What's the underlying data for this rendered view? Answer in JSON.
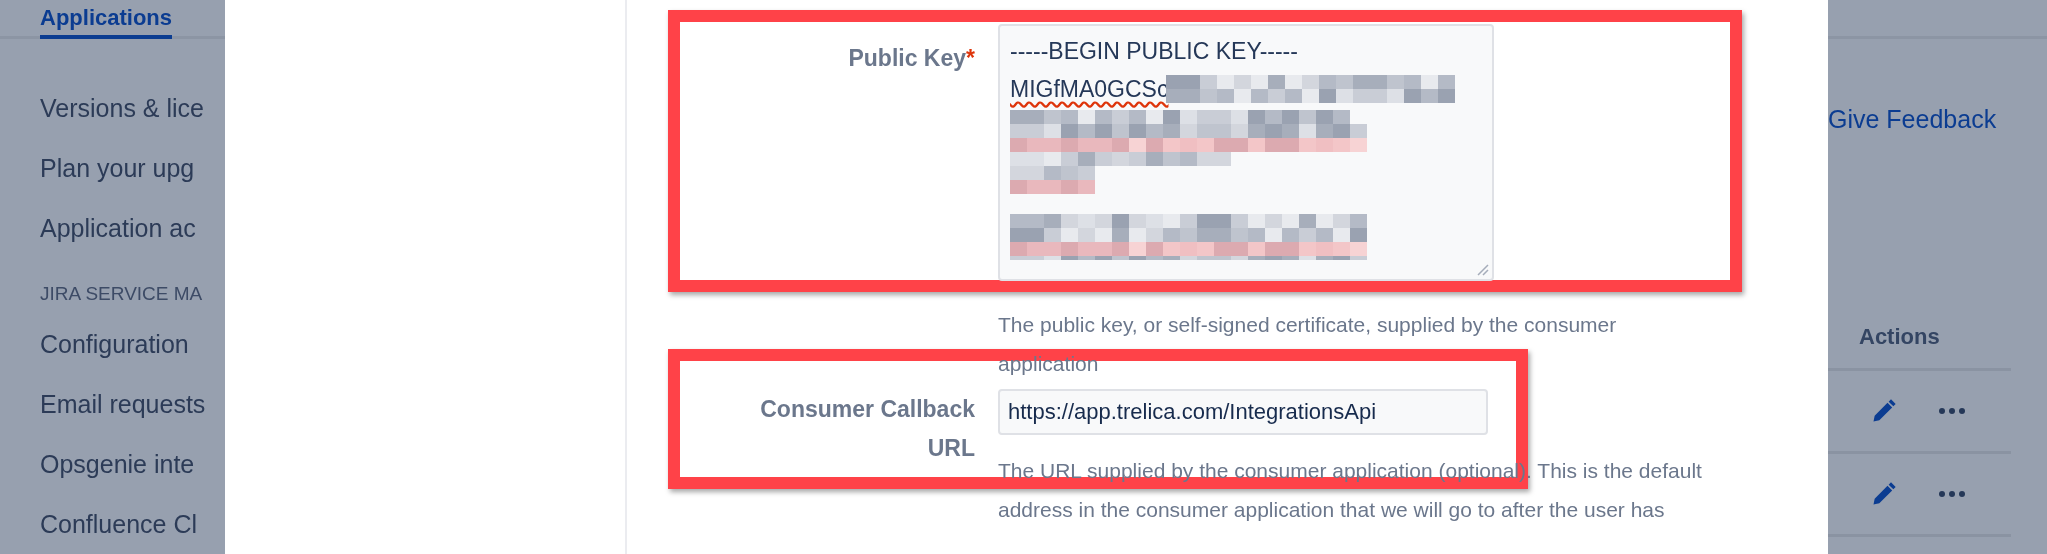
{
  "nav_tab": {
    "label": "Applications",
    "selected": true
  },
  "sidebar": {
    "sections": [
      {
        "items": [
          "Versions & lice",
          "Plan your upg",
          "Application ac"
        ]
      },
      {
        "heading": "JIRA SERVICE MA",
        "items": [
          "Configuration",
          "Email requests",
          "Opsgenie inte",
          "Confluence Cl"
        ]
      }
    ]
  },
  "dialog": {
    "required_marker": "*",
    "fields": [
      {
        "kind": "textarea",
        "label": "Public Key",
        "required": true,
        "highlighted": true,
        "lines": [
          "-----BEGIN PUBLIC KEY-----",
          "MIGfMA0GCSc"
        ],
        "help": "The public key, or self-signed certificate, supplied by the consumer application"
      },
      {
        "kind": "input",
        "label": "Consumer Callback URL",
        "required": false,
        "highlighted": true,
        "value": "https://app.trelica.com/IntegrationsApi",
        "help": "The URL supplied by the consumer application (optional). This is the default address in the consumer application that we will go to after the user has"
      }
    ]
  },
  "feedback_link": "Give Feedback",
  "table": {
    "columns": [
      "Actions"
    ],
    "rows": [
      {
        "kind": "actions"
      },
      {
        "kind": "actions"
      }
    ]
  }
}
